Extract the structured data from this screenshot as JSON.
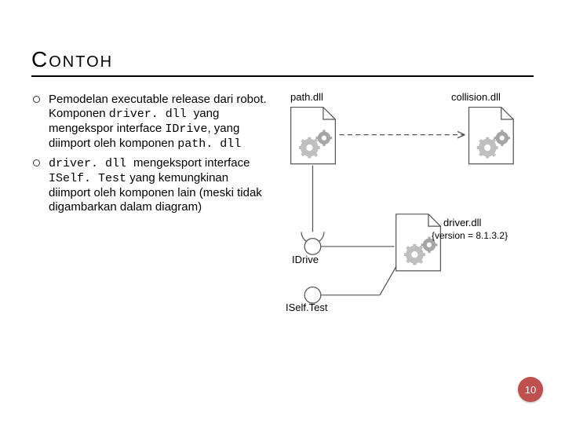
{
  "title": "Contoh",
  "bullets": [
    {
      "pre": "Pemodelan executable release dari robot. Komponen ",
      "code1": "driver. dll ",
      "mid1": "yang mengekspor interface ",
      "code2": "IDrive",
      "mid2": ", yang diimport oleh komponen ",
      "code3": "path. dll"
    },
    {
      "code1": "driver. dll ",
      "mid1": "mengeksport interface ",
      "code2": "ISelf. Test",
      "mid2": " yang kemungkinan diimport oleh komponen lain (meski tidak digambarkan dalam diagram)"
    }
  ],
  "diagram": {
    "components": {
      "path": "path.dll",
      "collision": "collision.dll",
      "driver": "driver.dll",
      "version": "{version = 8.1.3.2}"
    },
    "interfaces": {
      "idrive": "IDrive",
      "iselftest": "ISelf.Test"
    }
  },
  "page_number": "10"
}
